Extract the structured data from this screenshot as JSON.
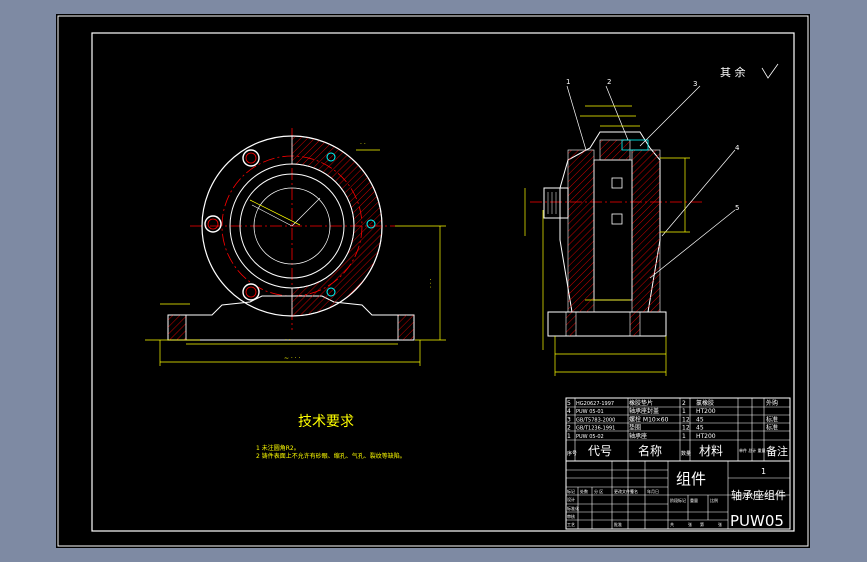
{
  "drawing": {
    "roughness": "其 余",
    "tech_req_title": "技术要求",
    "tech_req_items": [
      "1  未注圆角R2。",
      "2  铸件表面上不允许有砂眼、缩孔、气孔、裂纹等缺陷。"
    ],
    "balloons": [
      "1",
      "2",
      "3",
      "4",
      "5"
    ],
    "colors": {
      "background": "#000000",
      "border": "#ffffff",
      "dimension": "#ffff00",
      "hatch": "#ff0000",
      "centerline": "#ff0000",
      "part_outline": "#ffffff",
      "bolt": "#00ffff",
      "window_frame": "#7e8aa3"
    }
  },
  "bom": {
    "rows": [
      {
        "no": "5",
        "code": "HG20627-1997",
        "name": "橡胶垫片",
        "qty": "2",
        "material": "氯橡胶",
        "note": "外购"
      },
      {
        "no": "4",
        "code": "PUW 05-01",
        "name": "轴承座封盖",
        "qty": "1",
        "material": "HT200",
        "note": ""
      },
      {
        "no": "3",
        "code": "GB/T5783-2000",
        "name": "螺栓 M10×60",
        "qty": "12",
        "material": "45",
        "note": "标准"
      },
      {
        "no": "2",
        "code": "GB/T1236-1991",
        "name": "垫圈",
        "qty": "12",
        "material": "45",
        "note": "标准"
      },
      {
        "no": "1",
        "code": "PUW 05-02",
        "name": "轴承座",
        "qty": "1",
        "material": "HT200",
        "note": ""
      }
    ],
    "header": {
      "no": "序号",
      "code": "代号",
      "name": "名称",
      "qty": "数量",
      "material": "材料",
      "weight": "单件 总计 重量",
      "note": "备注"
    }
  },
  "title_block": {
    "type": "组件",
    "scale": "1",
    "part_name": "轴承座组件",
    "drawing_no": "PUW05",
    "small_labels": [
      "标记",
      "处数",
      "分 区",
      "更改文件号",
      "签名",
      "年月日",
      "设计",
      "标准化",
      "审核",
      "工艺",
      "批准",
      "阶段标记",
      "重量",
      "比例",
      "共",
      "张",
      "第",
      "张"
    ]
  }
}
